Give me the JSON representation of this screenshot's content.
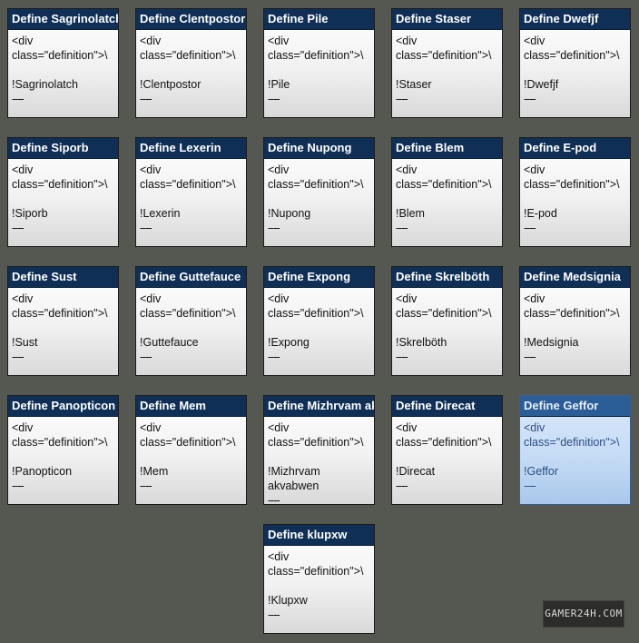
{
  "cards": [
    {
      "title": "Define Sagrinolatch",
      "code1": "<div",
      "code2": "class=\"definition\">\\",
      "name": "!Sagrinolatch",
      "dash": "----"
    },
    {
      "title": "Define Clentpostor",
      "code1": "<div",
      "code2": "class=\"definition\">\\",
      "name": "!Clentpostor",
      "dash": "----"
    },
    {
      "title": "Define Pile",
      "code1": "<div",
      "code2": "class=\"definition\">\\",
      "name": "!Pile",
      "dash": "----"
    },
    {
      "title": "Define Staser",
      "code1": "<div",
      "code2": "class=\"definition\">\\",
      "name": "!Staser",
      "dash": "----"
    },
    {
      "title": "Define Dwefjf",
      "code1": "<div",
      "code2": "class=\"definition\">\\",
      "name": "!Dwefjf",
      "dash": "----"
    },
    {
      "title": "Define Siporb",
      "code1": "<div",
      "code2": "class=\"definition\">\\",
      "name": "!Siporb",
      "dash": "----"
    },
    {
      "title": "Define Lexerin",
      "code1": "<div",
      "code2": "class=\"definition\">\\",
      "name": "!Lexerin",
      "dash": "----"
    },
    {
      "title": "Define Nupong",
      "code1": "<div",
      "code2": "class=\"definition\">\\",
      "name": "!Nupong",
      "dash": "----"
    },
    {
      "title": "Define Blem",
      "code1": "<div",
      "code2": "class=\"definition\">\\",
      "name": "!Blem",
      "dash": "----"
    },
    {
      "title": "Define E-pod",
      "code1": "<div",
      "code2": "class=\"definition\">\\",
      "name": "!E-pod",
      "dash": "----"
    },
    {
      "title": "Define Sust",
      "code1": "<div",
      "code2": "class=\"definition\">\\",
      "name": "!Sust",
      "dash": "----"
    },
    {
      "title": "Define Guttefauce",
      "code1": "<div",
      "code2": "class=\"definition\">\\",
      "name": "!Guttefauce",
      "dash": "----"
    },
    {
      "title": "Define Expong",
      "code1": "<div",
      "code2": "class=\"definition\">\\",
      "name": "!Expong",
      "dash": "----"
    },
    {
      "title": "Define Skrelböth",
      "code1": "<div",
      "code2": "class=\"definition\">\\",
      "name": "!Skrelböth",
      "dash": "----"
    },
    {
      "title": "Define Medsignia",
      "code1": "<div",
      "code2": "class=\"definition\">\\",
      "name": "!Medsignia",
      "dash": "----"
    },
    {
      "title": "Define Panopticon",
      "code1": "<div",
      "code2": "class=\"definition\">\\",
      "name": "!Panopticon",
      "dash": "----"
    },
    {
      "title": "Define Mem",
      "code1": "<div",
      "code2": "class=\"definition\">\\",
      "name": "!Mem",
      "dash": "----"
    },
    {
      "title": "Define Mizhrvam akvabwen",
      "code1": "<div",
      "code2": "class=\"definition\">\\",
      "name": "!Mizhrvam akvabwen",
      "dash": "----"
    },
    {
      "title": "Define Direcat",
      "code1": "<div",
      "code2": "class=\"definition\">\\",
      "name": "!Direcat",
      "dash": "----"
    },
    {
      "title": "Define Geffor",
      "code1": "<div",
      "code2": "class=\"definition\">\\",
      "name": "!Geffor",
      "dash": "----"
    },
    {
      "title": "Define klupxw",
      "code1": "<div",
      "code2": "class=\"definition\">\\",
      "name": "!Klupxw",
      "dash": "----"
    }
  ],
  "watermark": "GAMER24H.COM"
}
